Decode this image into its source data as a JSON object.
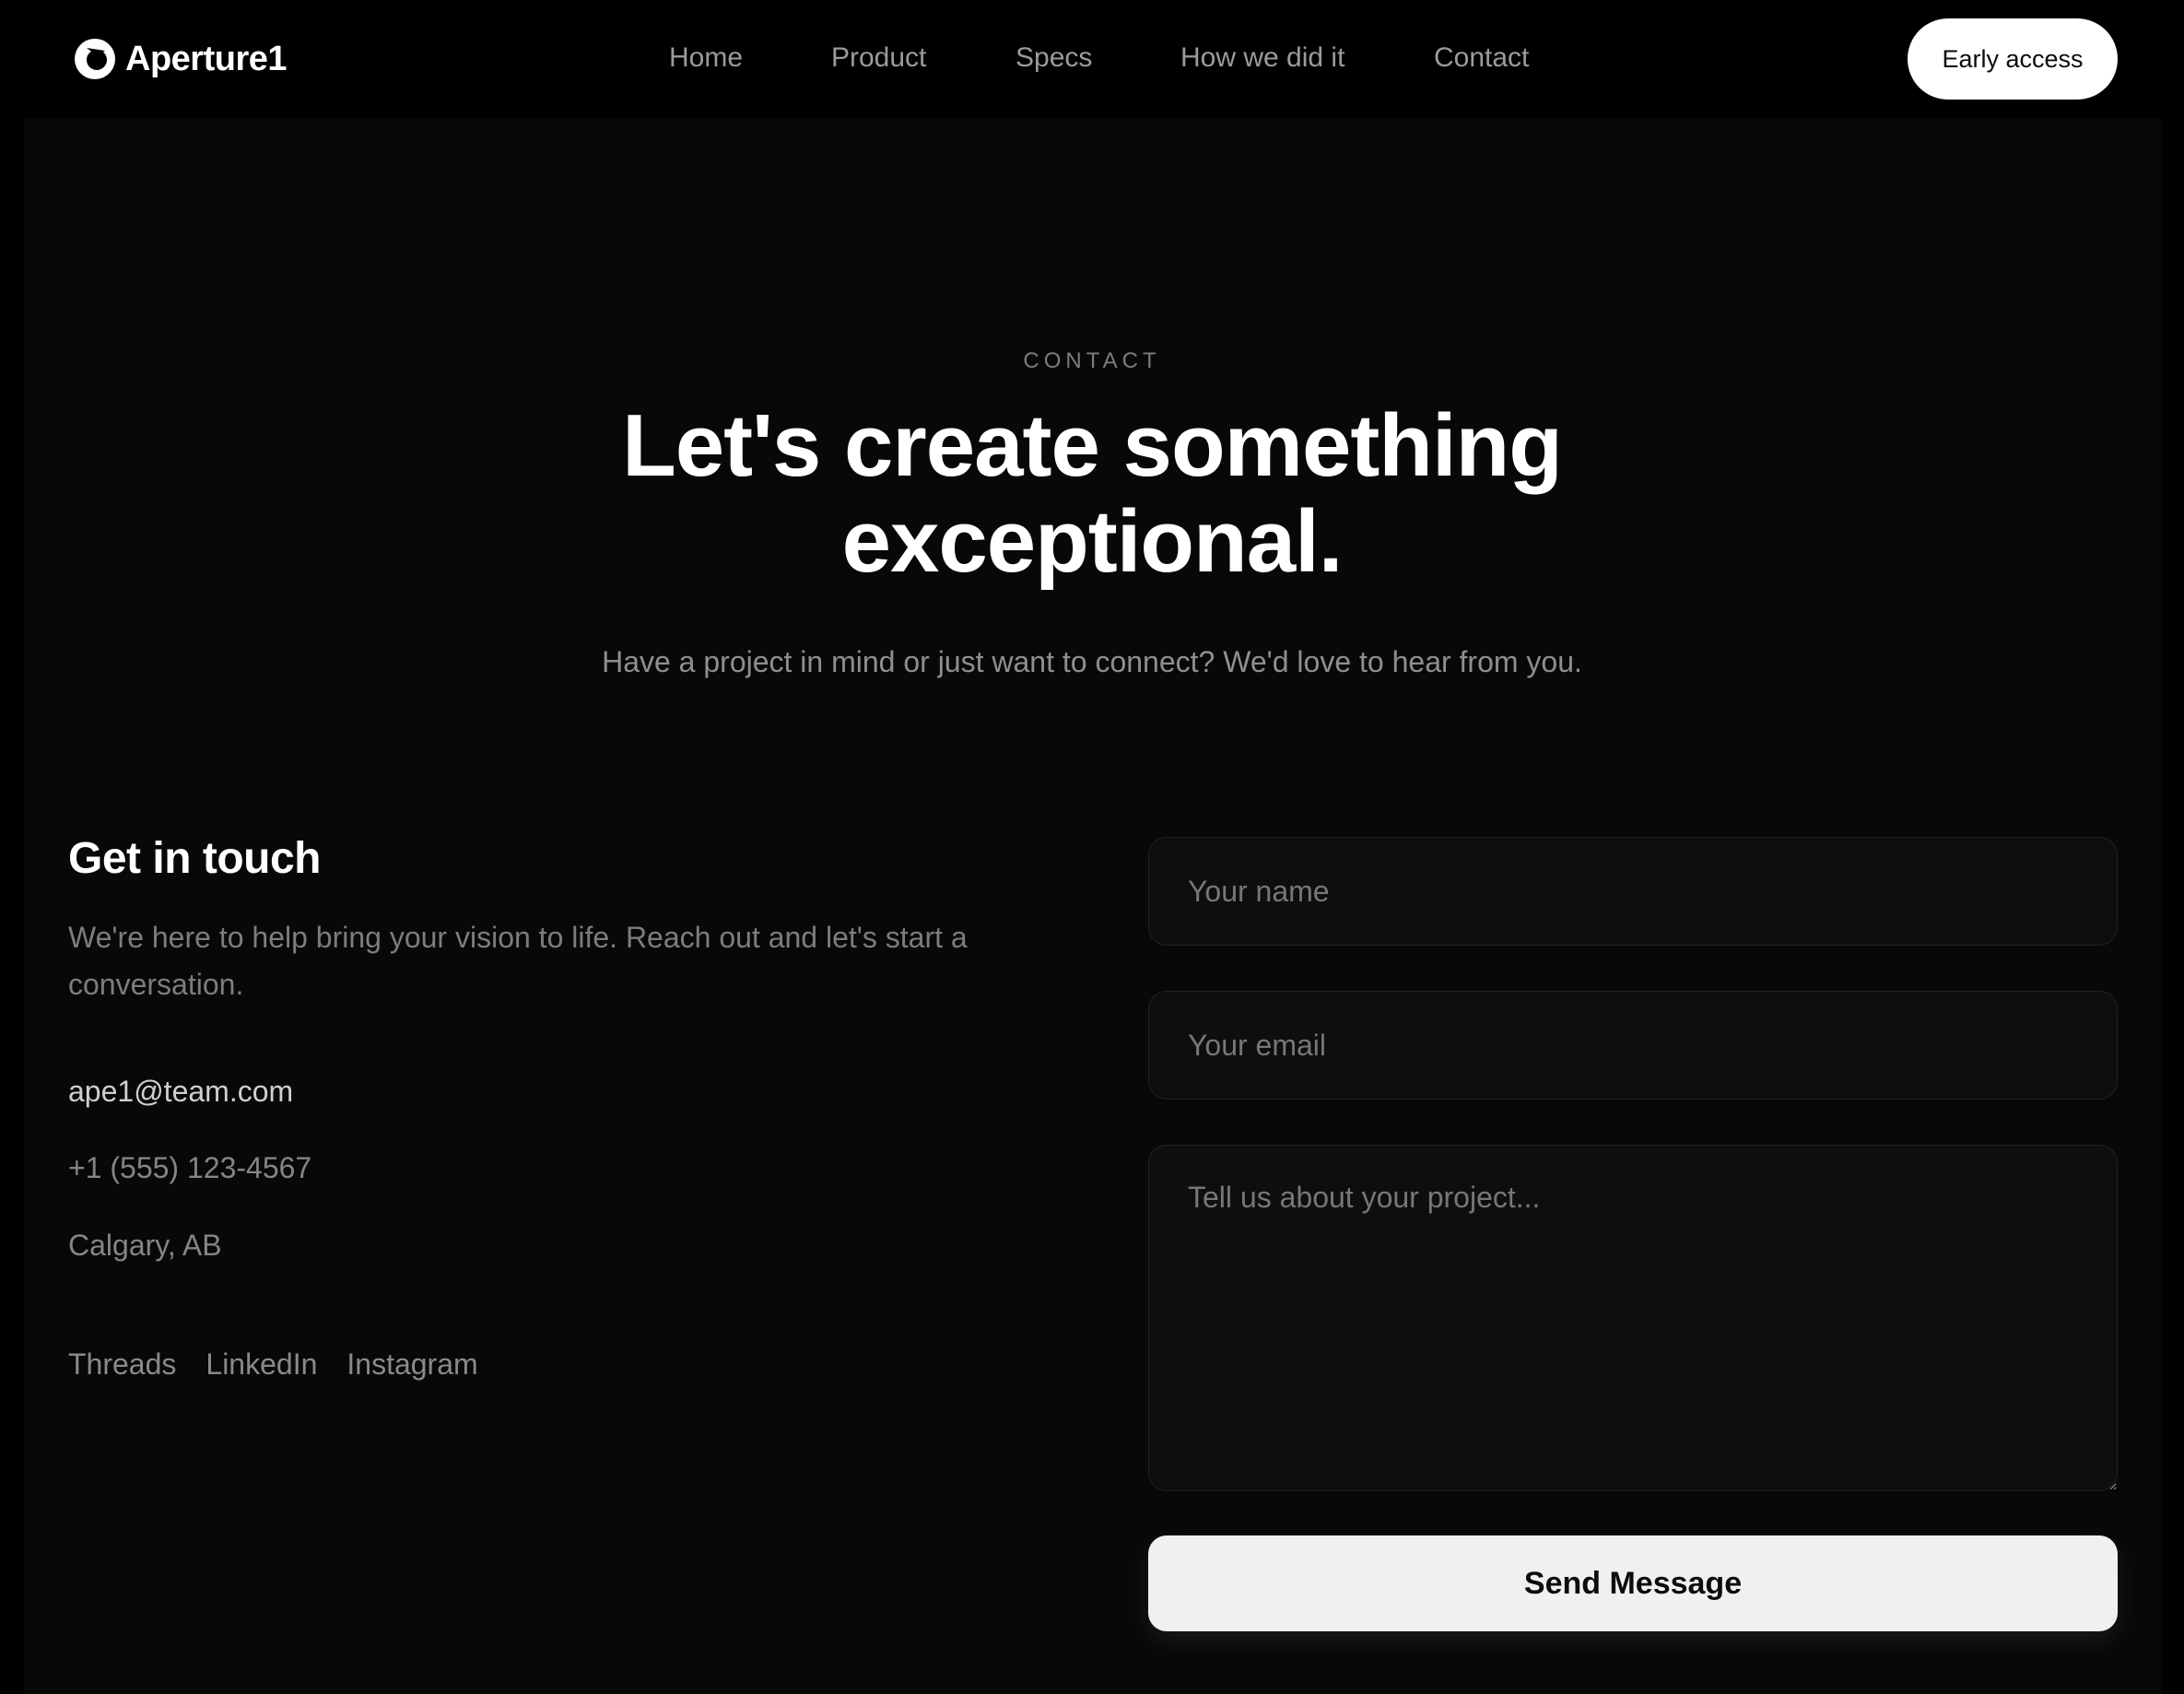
{
  "nav": {
    "brand": "Aperture1",
    "links": [
      "Home",
      "Product",
      "Specs",
      "How we did it",
      "Contact"
    ],
    "cta": "Early access"
  },
  "hero": {
    "eyebrow": "CONTACT",
    "headline_line1": "Let's create something",
    "headline_line2": "exceptional.",
    "subhead": "Have a project in mind or just want to connect? We'd love to hear from you."
  },
  "contact": {
    "title": "Get in touch",
    "description": "We're here to help bring your vision to life. Reach out and let's start a conversation.",
    "email": "ape1@team.com",
    "phone": "+1 (555) 123-4567",
    "location": "Calgary, AB",
    "socials": [
      "Threads",
      "LinkedIn",
      "Instagram"
    ]
  },
  "form": {
    "name_placeholder": "Your name",
    "email_placeholder": "Your email",
    "message_placeholder": "Tell us about your project...",
    "submit_label": "Send Message"
  },
  "colors": {
    "background": "#000000",
    "panel": "#080808",
    "field_bg": "#0e0e0e",
    "button_bg": "#eff1ef"
  }
}
